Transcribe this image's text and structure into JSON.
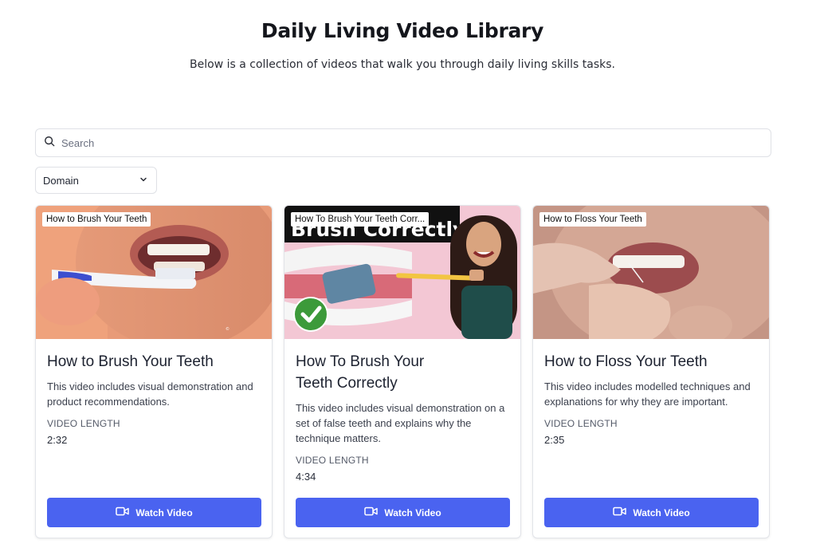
{
  "page": {
    "title": "Daily Living Video Library",
    "subtitle": "Below is a collection of videos that walk you through daily living skills tasks."
  },
  "search": {
    "placeholder": "Search",
    "icon": "search-icon"
  },
  "filter": {
    "selected": "Domain",
    "icon": "chevron-down-icon"
  },
  "colors": {
    "button": "#4a63f0",
    "text": "#1d2230",
    "border": "#e2e4e9"
  },
  "cards": [
    {
      "thumb_tag": "How to Brush Your Teeth",
      "title": "How to Brush Your Teeth",
      "description": "This video includes visual demonstration and product recommendations.",
      "length_label": "VIDEO LENGTH",
      "length": "2:32",
      "button_label": "Watch Video",
      "button_icon": "video-camera-icon"
    },
    {
      "thumb_tag": "How To Brush Your Teeth Corr...",
      "thumb_caption": "Brush Correctly",
      "title": "How To Brush Your Teeth Correctly",
      "description": "This video includes visual demonstration on a set of false teeth and explains why the technique matters.",
      "length_label": "VIDEO LENGTH",
      "length": "4:34",
      "button_label": "Watch Video",
      "button_icon": "video-camera-icon"
    },
    {
      "thumb_tag": "How to Floss Your Teeth",
      "title": "How to Floss Your Teeth",
      "description": "This video includes modelled techniques and explanations for why they are important.",
      "length_label": "VIDEO LENGTH",
      "length": "2:35",
      "button_label": "Watch Video",
      "button_icon": "video-camera-icon"
    }
  ]
}
